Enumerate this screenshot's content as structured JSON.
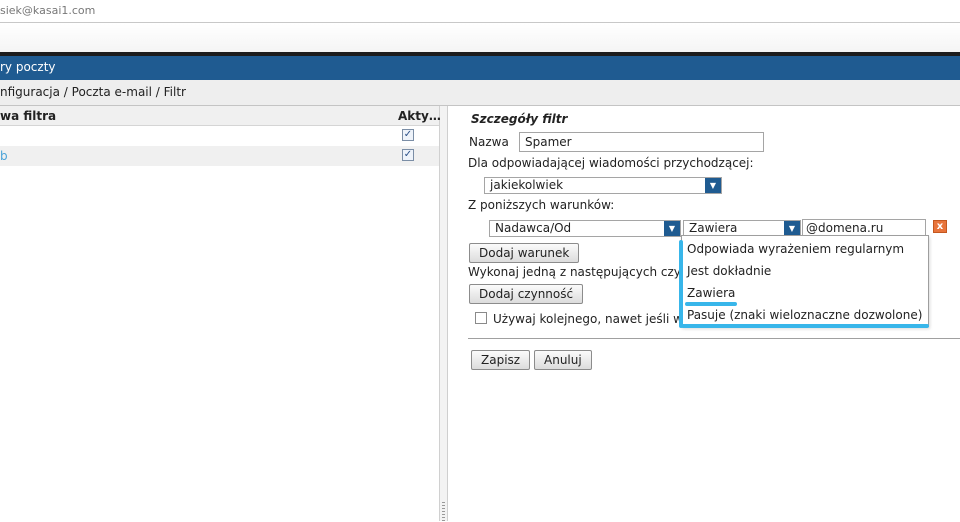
{
  "user": {
    "email": "siek@kasai1.com"
  },
  "title_bar": {
    "text": "ry poczty"
  },
  "breadcrumb": {
    "text": "nfiguracja / Poczta e-mail / Filtr"
  },
  "filters_list": {
    "col_name": "wa filtra",
    "col_active": "Akty…",
    "rows": [
      {
        "name": "",
        "active": "✓"
      },
      {
        "name": "b",
        "active": "✓"
      }
    ]
  },
  "details": {
    "title": "Szczegóły filtr",
    "name_label": "Nazwa",
    "name_value": "Spamer",
    "incoming_label": "Dla odpowiadającej wiadomości przychodzącej:",
    "match_value": "jakiekolwiek",
    "conditions_label": "Z poniższych warunków:",
    "condition": {
      "field": "Nadawca/Od",
      "operator": "Zawiera",
      "value": "@domena.ru",
      "remove_symbol": "x"
    },
    "add_condition_label": "Dodaj warunek",
    "actions_label": "Wykonaj jedną z następujących czynno",
    "add_action_label": "Dodaj czynność",
    "continue_label": "Używaj kolejnego, nawet jeśli wiad",
    "save_label": "Zapisz",
    "cancel_label": "Anuluj",
    "operator_options": [
      "Odpowiada wyrażeniem regularnym",
      "Jest dokładnie",
      "Zawiera",
      "Pasuje (znaki wieloznaczne dozwolone)"
    ]
  },
  "icons": {
    "dropdown_arrow": "chevron-down-icon",
    "check": "checkmark-icon",
    "remove": "close-icon"
  },
  "colors": {
    "title_bar": "#1f5b91",
    "highlight": "#38b6ea",
    "remove_button": "#e8743b"
  }
}
